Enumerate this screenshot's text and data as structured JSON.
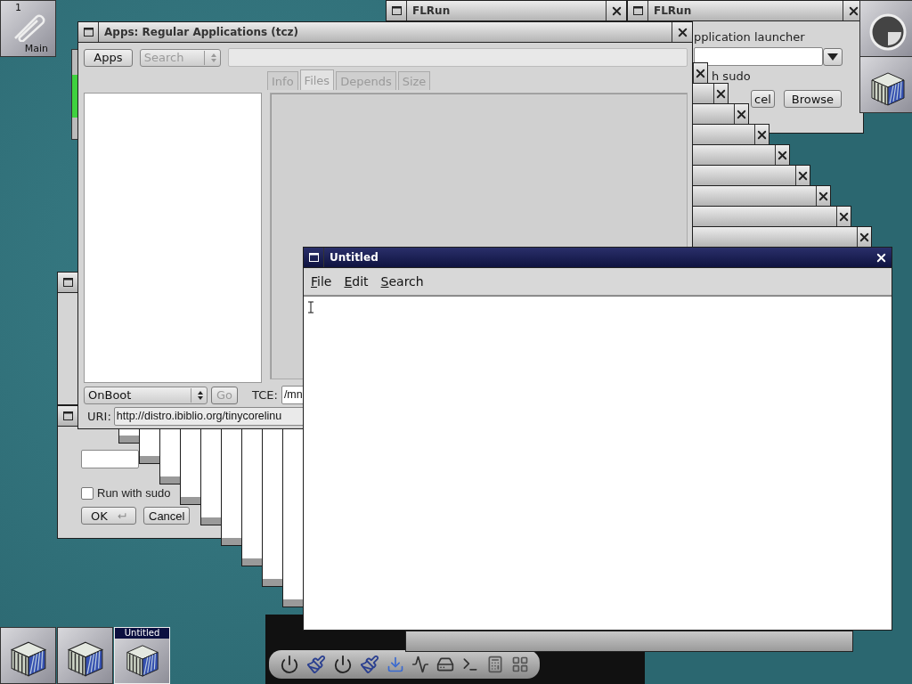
{
  "pager": {
    "desk": "1",
    "label": "Main"
  },
  "flrun_windows": [
    {
      "title": "FLRun"
    },
    {
      "title": "FLRun"
    }
  ],
  "launcher_dialog": {
    "heading": "pplication launcher",
    "checkbox_label": "h sudo",
    "buttons": [
      "cel",
      "Browse"
    ]
  },
  "run_dialog": {
    "checkbox": {
      "label": "Run with sudo",
      "checked": false
    },
    "buttons": [
      "OK",
      "Cancel"
    ]
  },
  "apps_window": {
    "title": "Apps: Regular Applications (tcz)",
    "menu_button": "Apps",
    "search_mode": {
      "value": "Search",
      "disabled": true
    },
    "tabs": [
      {
        "label": "Info",
        "selected": false,
        "disabled": true
      },
      {
        "label": "Files",
        "selected": true,
        "disabled": true
      },
      {
        "label": "Depends",
        "selected": false,
        "disabled": true
      },
      {
        "label": "Size",
        "selected": false,
        "disabled": true
      }
    ],
    "load_mode": "OnBoot",
    "go_button": {
      "label": "Go",
      "disabled": true
    },
    "tce_label": "TCE:",
    "tce_value": "/mn",
    "uri_label": "URI:",
    "uri_value": "http://distro.ibiblio.org/tinycorelinu"
  },
  "editor": {
    "title": "Untitled",
    "menu": [
      "File",
      "Edit",
      "Search"
    ]
  },
  "taskbar": [
    {
      "selected": false
    },
    {
      "selected": false
    },
    {
      "label": "Untitled",
      "selected": true
    }
  ]
}
